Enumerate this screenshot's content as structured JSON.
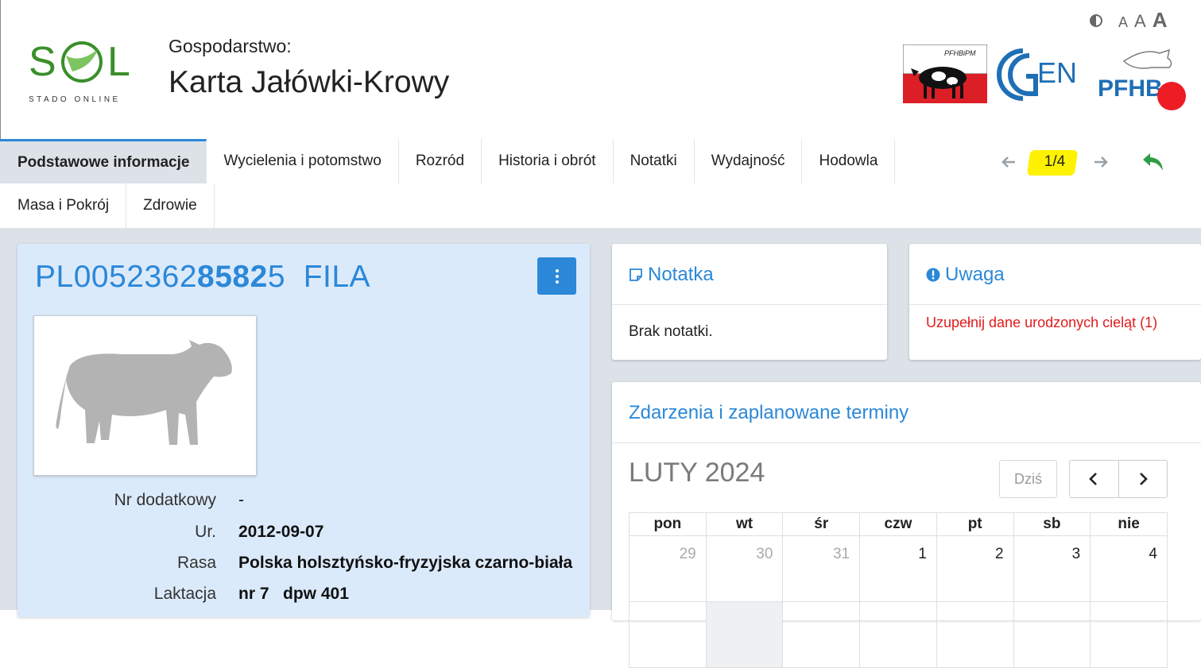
{
  "header": {
    "logo_caption": "STADO ONLINE",
    "farm_label": "Gospodarstwo:",
    "page_title": "Karta Jałówki-Krowy",
    "font_sizes": [
      "A",
      "A",
      "A"
    ],
    "contrast_icon": "contrast-icon",
    "partner_logo_text": "PFHBiPM"
  },
  "tabs": {
    "row1": [
      "Podstawowe informacje",
      "Wycielenia i potomstwo",
      "Rozród",
      "Historia i obrót",
      "Notatki",
      "Wydajność",
      "Hodowla"
    ],
    "row2": [
      "Masa i Pokrój",
      "Zdrowie"
    ],
    "active": "Podstawowe informacje"
  },
  "pager": {
    "count": "1/4"
  },
  "animal": {
    "id_part1": "PL0052362",
    "id_part2": "8582",
    "id_part3": "5",
    "name": "FILA",
    "rows": [
      {
        "label": "Nr dodatkowy",
        "value": "-"
      },
      {
        "label": "Ur.",
        "value": "2012-09-07"
      },
      {
        "label": "Rasa",
        "value": "Polska holsztyńsko-fryzyjska czarno-biała"
      },
      {
        "label": "Laktacja",
        "value": "nr 7   dpw 401"
      }
    ]
  },
  "note": {
    "title": "Notatka",
    "text": "Brak notatki."
  },
  "alert": {
    "title": "Uwaga",
    "text": "Uzupełnij dane urodzonych cieląt (1)"
  },
  "events": {
    "title": "Zdarzenia i zaplanowane terminy",
    "month": "LUTY 2024",
    "today_label": "Dziś",
    "weekdays": [
      "pon",
      "wt",
      "śr",
      "czw",
      "pt",
      "sb",
      "nie"
    ],
    "week1": [
      "29",
      "30",
      "31",
      "1",
      "2",
      "3",
      "4"
    ]
  },
  "colors": {
    "accent": "#2b88d8",
    "alert": "#e01b1b",
    "background": "#dde1e8",
    "highlight": "#fff200"
  }
}
